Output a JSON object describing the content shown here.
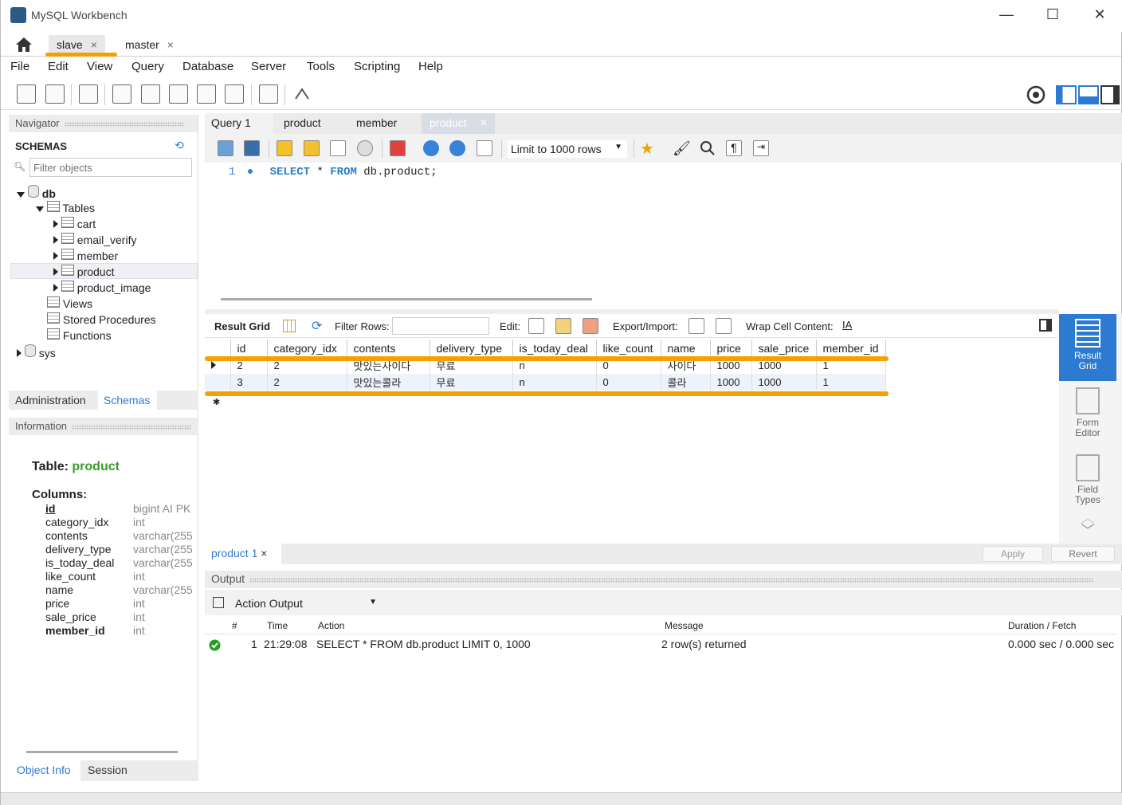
{
  "window": {
    "title": "MySQL Workbench",
    "minimize": "—",
    "maximize": "☐",
    "close": "✕"
  },
  "conn_tabs": [
    {
      "label": "slave",
      "close": "×"
    },
    {
      "label": "master",
      "close": "×"
    }
  ],
  "menu": [
    "File",
    "Edit",
    "View",
    "Query",
    "Database",
    "Server",
    "Tools",
    "Scripting",
    "Help"
  ],
  "navigator": {
    "header": "Navigator",
    "schemas_title": "SCHEMAS",
    "filter_placeholder": "Filter objects",
    "db": "db",
    "tables": "Tables",
    "table_items": [
      "cart",
      "email_verify",
      "member",
      "product",
      "product_image"
    ],
    "views": "Views",
    "stored_procedures": "Stored Procedures",
    "functions": "Functions",
    "sys": "sys",
    "bottom_tabs": [
      "Administration",
      "Schemas"
    ]
  },
  "info": {
    "header": "Information",
    "table_label": "Table:",
    "table_name": "product",
    "columns_label": "Columns:",
    "columns": [
      [
        "id",
        "bigint AI PK"
      ],
      [
        "category_idx",
        "int"
      ],
      [
        "contents",
        "varchar(255"
      ],
      [
        "delivery_type",
        "varchar(255"
      ],
      [
        "is_today_deal",
        "varchar(255"
      ],
      [
        "like_count",
        "int"
      ],
      [
        "name",
        "varchar(255"
      ],
      [
        "price",
        "int"
      ],
      [
        "sale_price",
        "int"
      ],
      [
        "member_id",
        "int"
      ]
    ],
    "bottom_tabs": [
      "Object Info",
      "Session"
    ]
  },
  "query_tabs": [
    "Query 1",
    "product",
    "member",
    "product"
  ],
  "editor": {
    "limit": "Limit to 1000 rows",
    "line_no": "1",
    "kw1": "SELECT",
    "star": "*",
    "kw2": "FROM",
    "rest": "db.product;"
  },
  "result_tb": {
    "result_grid": "Result Grid",
    "filter_rows": "Filter Rows:",
    "edit": "Edit:",
    "export": "Export/Import:",
    "wrap": "Wrap Cell Content:"
  },
  "grid": {
    "headers": [
      "id",
      "category_idx",
      "contents",
      "delivery_type",
      "is_today_deal",
      "like_count",
      "name",
      "price",
      "sale_price",
      "member_id"
    ],
    "rows": [
      [
        "2",
        "2",
        "맛있는사이다",
        "무료",
        "n",
        "0",
        "사이다",
        "1000",
        "1000",
        "1"
      ],
      [
        "3",
        "2",
        "맛있는콜라",
        "무료",
        "n",
        "0",
        "콜라",
        "1000",
        "1000",
        "1"
      ]
    ]
  },
  "side_buttons": [
    "Result Grid",
    "Form Editor",
    "Field Types"
  ],
  "result_tab": {
    "label": "product 1",
    "close": "×",
    "apply": "Apply",
    "revert": "Revert"
  },
  "output": {
    "header": "Output",
    "selector": "Action Output",
    "headers": [
      "#",
      "Time",
      "Action",
      "Message",
      "Duration / Fetch"
    ],
    "row": [
      "1",
      "21:29:08",
      "SELECT * FROM db.product LIMIT 0, 1000",
      "2 row(s) returned",
      "0.000 sec / 0.000 sec"
    ]
  }
}
